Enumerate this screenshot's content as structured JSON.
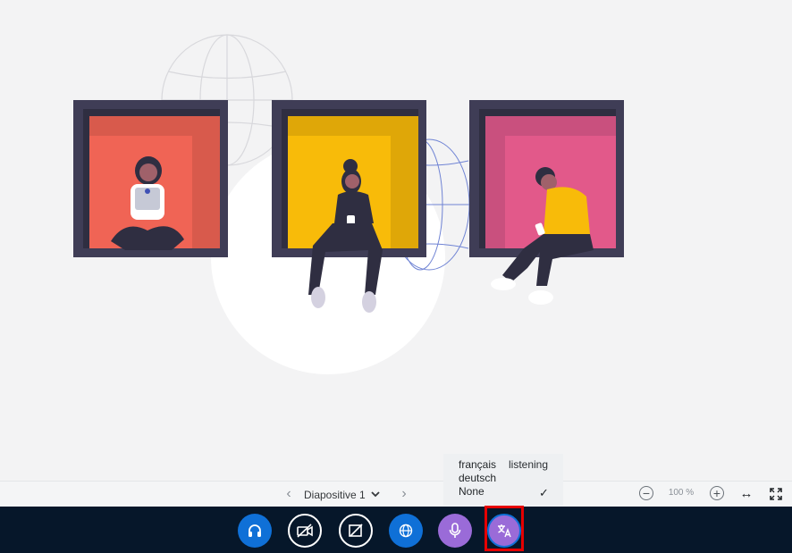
{
  "slide_bar": {
    "prev_icon": "chevron-left-icon",
    "next_icon": "chevron-right-icon",
    "slide_label": "Diapositive 1",
    "dropdown_icon": "chevron-down-icon",
    "zoom_out_icon": "zoom-out-icon",
    "zoom_level": "100 %",
    "zoom_in_icon": "zoom-in-icon",
    "fit_width_icon": "fit-width-icon",
    "fullscreen_icon": "fullscreen-icon"
  },
  "language_menu": {
    "header": "listening",
    "options": [
      "français",
      "deutsch",
      "None"
    ],
    "selected": "None",
    "check_icon": "checkmark-icon"
  },
  "action_bar": {
    "buttons": [
      {
        "name": "audio-button",
        "icon": "headphones-icon",
        "color": "#0f70d7"
      },
      {
        "name": "video-button",
        "icon": "camera-off-icon",
        "color": "#ffffff"
      },
      {
        "name": "screenshare-button",
        "icon": "screenshare-off-icon",
        "color": "#ffffff"
      },
      {
        "name": "language-button",
        "icon": "globe-icon",
        "color": "#0f70d7"
      },
      {
        "name": "microphone-button",
        "icon": "microphone-icon",
        "color": "#9a6bd8"
      },
      {
        "name": "translation-button",
        "icon": "translate-icon",
        "color": "#9a6bd8"
      }
    ],
    "highlight_color": "#e60000"
  },
  "colors": {
    "frame": "#3f3d56",
    "red_window": "#f06455",
    "yellow_window": "#f8bb09",
    "pink_window": "#e2598a",
    "action_bar_bg": "#06172a"
  }
}
